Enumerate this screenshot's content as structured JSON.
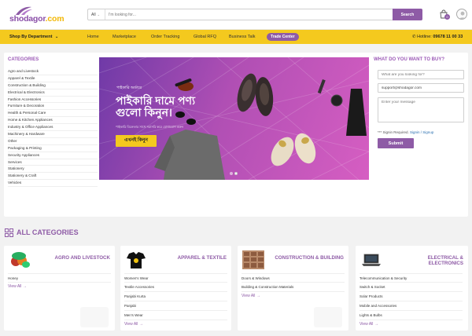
{
  "header": {
    "logo_main": "shodagor",
    "logo_suffix": ".com",
    "search": {
      "category": "All",
      "placeholder": "I'm looking for...",
      "button": "Search"
    },
    "cart_count": "0"
  },
  "nav": {
    "department": "Shop By Department",
    "items": [
      "Home",
      "Marketplace",
      "Order Tracking",
      "Global RFQ",
      "Business Talk"
    ],
    "trade_center": "Trade Center",
    "hotline_label": "Hotline:",
    "hotline_number": "09678 11 00 33"
  },
  "categories": {
    "title": "CATEGORIES",
    "items": [
      "Agro and Livestock",
      "Apparel & Textile",
      "Construction & Building",
      "Electrical & Electronics",
      "Fashion Accessories",
      "Furniture & Decoration",
      "Health & Personal Care",
      "Home & Kitchen Appliances",
      "Industry & Office Appliances",
      "Machinery & Hardware",
      "Other",
      "Packaging & Printing",
      "Security Appliances",
      "Services",
      "Stationery",
      "Stationery & Craft",
      "Vehicles"
    ]
  },
  "banner": {
    "tag": "পাইকারি অর্ডারে",
    "headline": "পাইকারি দামে পণ্য গুলো কিনুন।",
    "sub": "পাইকারি বিক্রেতার সাথে সরাসরি করে যোগাযোগ করুন",
    "cta": "এখনই কিনুন",
    "slides": 2,
    "active_slide": 2
  },
  "buy": {
    "title": "WHAT DO YOU WANT TO BUY?",
    "looking_placeholder": "What are you looking for?",
    "email_value": "support@shodagor.com",
    "message_placeholder": "Enter your message",
    "signin_prefix": "*** Signin Required.",
    "signin_link": "Signin / Signup",
    "submit": "Submit"
  },
  "all_categories": {
    "title": "ALL CATEGORIES",
    "view_all": "View All",
    "cards": [
      {
        "title": "AGRO AND LIVESTOCK",
        "items": [
          "Honey"
        ]
      },
      {
        "title": "APPAREL & TEXTILE",
        "items": [
          "Women's Wear",
          "Textile Accessories",
          "Panjabi Kurta",
          "Panjabi",
          "Men's Wear"
        ]
      },
      {
        "title": "CONSTRUCTION & BUILDING",
        "items": [
          "Doors & Windows",
          "Building & Construction Materials"
        ]
      },
      {
        "title": "ELECTRICAL & ELECTRONICS",
        "items": [
          "Telecommunication & Security",
          "Switch & Socket",
          "Solar Products",
          "Mobile and Accessories",
          "Lights & Bulbs"
        ]
      }
    ]
  },
  "colors": {
    "brand_purple": "#8e5ba6",
    "nav_yellow": "#f4c91e"
  }
}
